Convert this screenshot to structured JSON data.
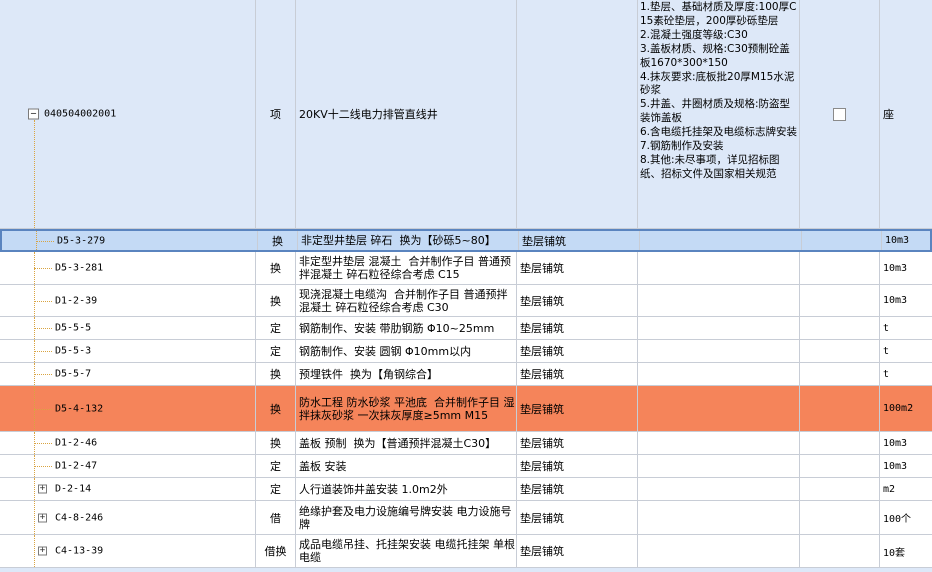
{
  "parent": {
    "expander": "−",
    "code": "040504002001",
    "type": "项",
    "name": "20KV十二线电力排管直线井",
    "category": "",
    "features": "1.垫层、基础材质及厚度:100厚C15素砼垫层，200厚砂砾垫层\n2.混凝土强度等级:C30\n3.盖板材质、规格:C30预制砼盖板1670*300*150\n4.抹灰要求:底板批20厚M15水泥砂浆\n5.井盖、井圈材质及规格:防盗型装饰盖板\n6.含电缆托挂架及电缆标志牌安装\n7.钢筋制作及安装\n8.其他:未尽事项，详见招标图纸、招标文件及国家相关规范",
    "unit": "座"
  },
  "rows": [
    {
      "code": "D5-3-279",
      "type": "换",
      "name": "非定型井垫层 碎石  换为【砂砾5~80】",
      "category": "垫层铺筑",
      "unit": "10m3",
      "expander": ""
    },
    {
      "code": "D5-3-281",
      "type": "换",
      "name": "非定型井垫层 混凝土  合并制作子目 普通预拌混凝土 碎石粒径综合考虑 C15",
      "category": "垫层铺筑",
      "unit": "10m3",
      "expander": ""
    },
    {
      "code": "D1-2-39",
      "type": "换",
      "name": "现浇混凝土电缆沟  合并制作子目 普通预拌混凝土 碎石粒径综合考虑 C30",
      "category": "垫层铺筑",
      "unit": "10m3",
      "expander": ""
    },
    {
      "code": "D5-5-5",
      "type": "定",
      "name": "钢筋制作、安装 带肋钢筋 Φ10~25mm",
      "category": "垫层铺筑",
      "unit": "t",
      "expander": ""
    },
    {
      "code": "D5-5-3",
      "type": "定",
      "name": "钢筋制作、安装 圆钢 Φ10mm以内",
      "category": "垫层铺筑",
      "unit": "t",
      "expander": ""
    },
    {
      "code": "D5-5-7",
      "type": "换",
      "name": "预埋铁件  换为【角钢综合】",
      "category": "垫层铺筑",
      "unit": "t",
      "expander": ""
    },
    {
      "code": "D5-4-132",
      "type": "换",
      "name": "防水工程 防水砂浆 平池底  合并制作子目 湿拌抹灰砂浆 一次抹灰厚度≥5mm M15",
      "category": "垫层铺筑",
      "unit": "100m2",
      "expander": ""
    },
    {
      "code": "D1-2-46",
      "type": "换",
      "name": "盖板 预制  换为【普通预拌混凝土C30】",
      "category": "垫层铺筑",
      "unit": "10m3",
      "expander": ""
    },
    {
      "code": "D1-2-47",
      "type": "定",
      "name": "盖板 安装",
      "category": "垫层铺筑",
      "unit": "10m3",
      "expander": ""
    },
    {
      "code": "D-2-14",
      "type": "定",
      "name": "人行道装饰井盖安装 1.0m2外",
      "category": "垫层铺筑",
      "unit": "m2",
      "expander": "+"
    },
    {
      "code": "C4-8-246",
      "type": "借",
      "name": "绝缘护套及电力设施编号牌安装 电力设施号牌",
      "category": "垫层铺筑",
      "unit": "100个",
      "expander": "+"
    },
    {
      "code": "C4-13-39",
      "type": "借换",
      "name": "成品电缆吊挂、托挂架安装 电缆托挂架 单根电缆",
      "category": "垫层铺筑",
      "unit": "10套",
      "expander": "+"
    }
  ],
  "colors": {
    "selected_row": "#c4daf5",
    "highlight_row": "#f5845a",
    "parent_row": "#dde8f8"
  }
}
